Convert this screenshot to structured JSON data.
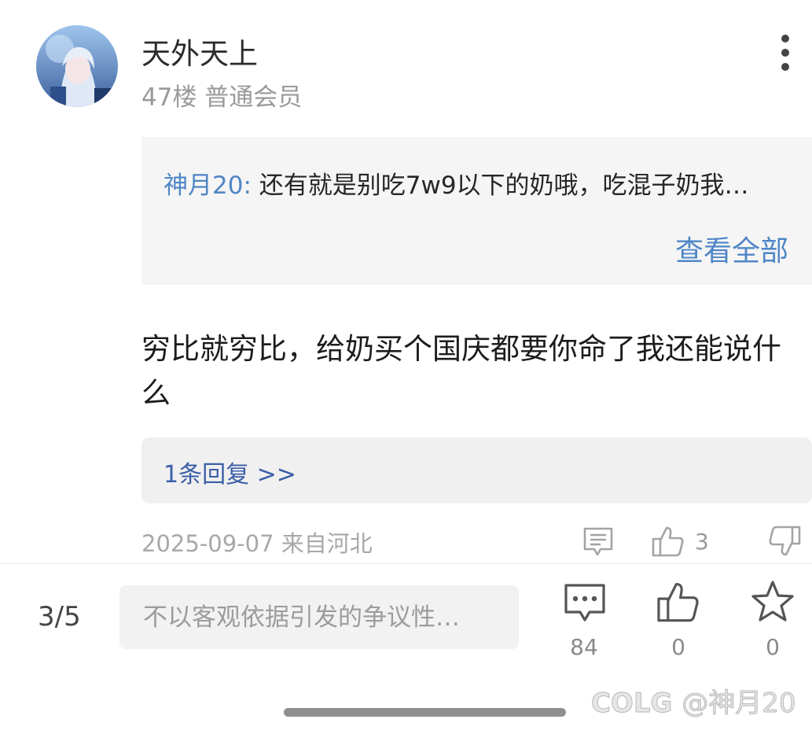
{
  "post": {
    "username": "天外天上",
    "floor_meta": "47楼 普通会员",
    "quote_author": "神月20:",
    "quote_text": "还有就是别吃7w9以下的奶哦，吃混子奶我…",
    "view_all": "查看全部",
    "comment": "穷比就穷比，给奶买个国庆都要你命了我还能说什么",
    "reply_link": "1条回复 >>",
    "date_location": "2025-09-07 来自河北",
    "like_count": "3"
  },
  "bottom_bar": {
    "page_indicator": "3/5",
    "input_placeholder": "不以客观依据引发的争议性…",
    "comment_count": "84",
    "like_count": "0",
    "fav_count": "0"
  },
  "watermark": {
    "logo": "COLG",
    "handle": "@神月20"
  },
  "icons": [
    "more-vertical-icon",
    "comment-icon",
    "thumbs-up-icon",
    "thumbs-down-icon",
    "chat-bubble-icon",
    "star-icon"
  ],
  "colors": {
    "link": "#4f86c6",
    "reply": "#3b5ea8",
    "muted": "#9a9a9a"
  }
}
